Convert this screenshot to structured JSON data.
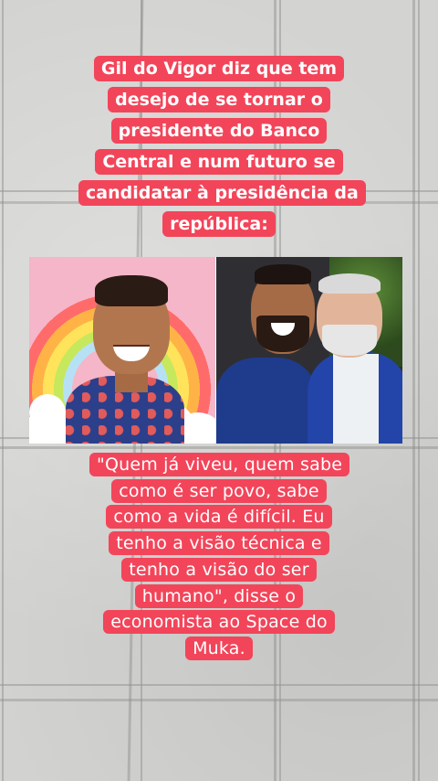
{
  "post": {
    "title_caption": "Gil do Vigor diz que tem desejo de se tornar o presidente do Banco Central e num futuro se candidatar à presidência da república:",
    "quote_caption": "\"Quem já viveu, quem sabe como é ser povo, sabe como a vida é difícil. Eu tenho a visão técnica e tenho a visão do ser humano\", disse o economista ao Space do Muka."
  },
  "colors": {
    "caption_background": "#f2455a",
    "caption_text": "#ffffff",
    "floor_tile": "#d3d3d1"
  },
  "icons": {
    "left_photo": "man-smiling-rainbow-photo",
    "right_photo": "two-men-posing-photo"
  }
}
